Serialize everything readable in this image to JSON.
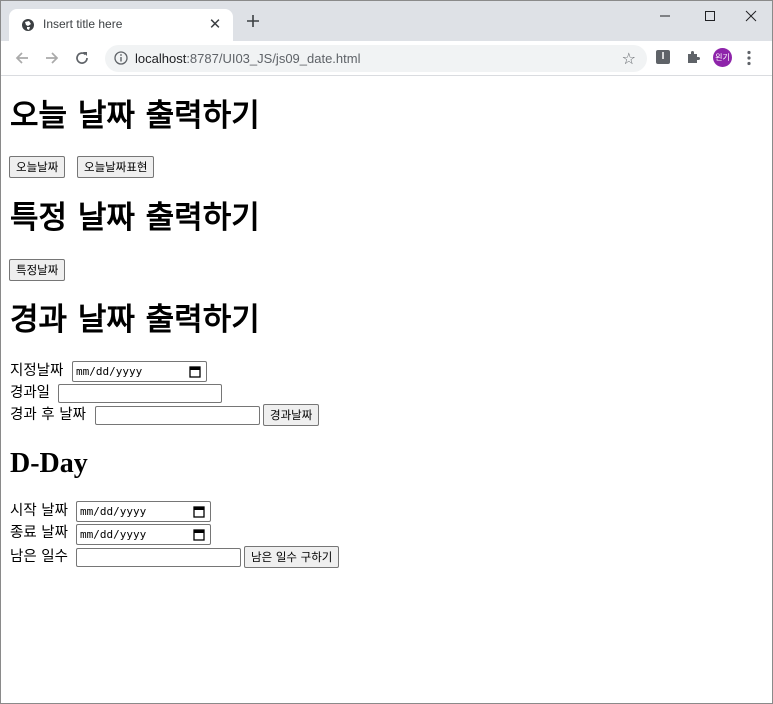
{
  "browser": {
    "tab_title": "Insert title here",
    "url_host": "localhost",
    "url_path": ":8787/UI03_JS/js09_date.html",
    "avatar_text": "왼기",
    "ext_letter": "I"
  },
  "today_section": {
    "heading": "오늘 날짜 출력하기",
    "buttons": [
      "오늘날짜",
      "오늘날짜표현"
    ]
  },
  "specific_section": {
    "heading": "특정 날짜 출력하기",
    "button": "특정날짜"
  },
  "elapsed_section": {
    "heading": "경과 날짜 출력하기",
    "date_label": "지정날짜",
    "days_label": "경과일",
    "result_label": "경과 후 날짜",
    "button": "경과날짜"
  },
  "dday_section": {
    "heading": "D-Day",
    "start_label": "시작 날짜",
    "end_label": "종료 날짜",
    "remain_label": "남은 일수",
    "button": "남은 일수 구하기"
  },
  "date_placeholder": "mm/dd/yyyy",
  "colors": {
    "titlebar": "#dee1e6",
    "omnibox": "#f1f3f4",
    "avatar": "#8e24aa"
  }
}
